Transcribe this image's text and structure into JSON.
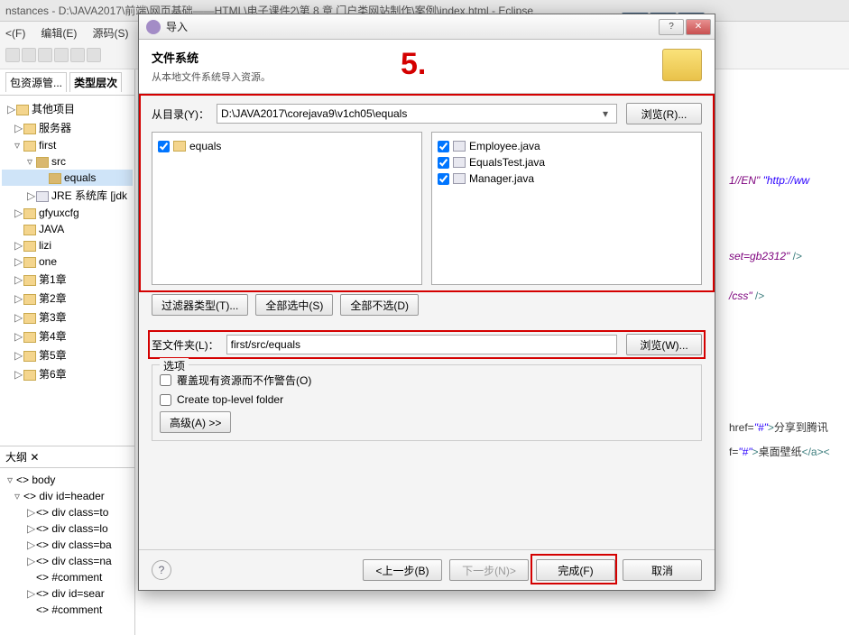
{
  "bg": {
    "title": "nstances - D:\\JAVA2017\\前端\\网页基础——HTML\\电子课件2\\第 8 章 门户类网站制作\\案例\\index.html - Eclipse",
    "menu": [
      "<(F)",
      "编辑(E)",
      "源码(S)"
    ],
    "tabs": {
      "pkg": "包资源管...",
      "hier": "类型层次"
    },
    "tree": [
      {
        "label": "其他项目",
        "lvl": 0,
        "exp": "▷",
        "ico": "fico"
      },
      {
        "label": "服务器",
        "lvl": 1,
        "exp": "▷",
        "ico": "fico"
      },
      {
        "label": "first",
        "lvl": 1,
        "exp": "▿",
        "ico": "fico"
      },
      {
        "label": "src",
        "lvl": 2,
        "exp": "▿",
        "ico": "fico pkg"
      },
      {
        "label": "equals",
        "lvl": 3,
        "exp": "",
        "ico": "fico pkg",
        "selected": true
      },
      {
        "label": "JRE 系统库 [jdk",
        "lvl": 2,
        "exp": "▷",
        "ico": "fico cls"
      },
      {
        "label": "gfyuxcfg",
        "lvl": 1,
        "exp": "▷",
        "ico": "fico"
      },
      {
        "label": "JAVA",
        "lvl": 1,
        "exp": "",
        "ico": "fico"
      },
      {
        "label": "lizi",
        "lvl": 1,
        "exp": "▷",
        "ico": "fico"
      },
      {
        "label": "one",
        "lvl": 1,
        "exp": "▷",
        "ico": "fico"
      },
      {
        "label": "第1章",
        "lvl": 1,
        "exp": "▷",
        "ico": "fico"
      },
      {
        "label": "第2章",
        "lvl": 1,
        "exp": "▷",
        "ico": "fico"
      },
      {
        "label": "第3章",
        "lvl": 1,
        "exp": "▷",
        "ico": "fico"
      },
      {
        "label": "第4章",
        "lvl": 1,
        "exp": "▷",
        "ico": "fico"
      },
      {
        "label": "第5章",
        "lvl": 1,
        "exp": "▷",
        "ico": "fico"
      },
      {
        "label": "第6章",
        "lvl": 1,
        "exp": "▷",
        "ico": "fico"
      }
    ],
    "outline_title": "大纲",
    "outline": [
      {
        "label": "body",
        "lvl": 0,
        "exp": "▿"
      },
      {
        "label": "div id=header",
        "lvl": 1,
        "exp": "▿"
      },
      {
        "label": "div class=to",
        "lvl": 2,
        "exp": "▷"
      },
      {
        "label": "div class=lo",
        "lvl": 2,
        "exp": "▷"
      },
      {
        "label": "div class=ba",
        "lvl": 2,
        "exp": "▷"
      },
      {
        "label": "div class=na",
        "lvl": 2,
        "exp": "▷"
      },
      {
        "label": "#comment",
        "lvl": 2,
        "exp": ""
      },
      {
        "label": "div id=sear",
        "lvl": 2,
        "exp": "▷"
      },
      {
        "label": "#comment",
        "lvl": 2,
        "exp": ""
      }
    ],
    "code_lines": [
      {
        "frag": [
          {
            "t": "1//EN\" ",
            "c": "attr"
          },
          {
            "t": "\"http://ww",
            "c": "str"
          }
        ]
      },
      {
        "frag": [
          {
            "t": "set=gb2312\"",
            "c": "attr"
          },
          {
            "t": " />",
            "c": "tag"
          }
        ]
      },
      {
        "frag": [
          {
            "t": "/css\"",
            "c": "attr"
          },
          {
            "t": " />",
            "c": "tag"
          }
        ]
      },
      {
        "frag": [
          {
            "t": "href=",
            "c": ""
          },
          {
            "t": "\"#\"",
            "c": "str"
          },
          {
            "t": ">",
            "c": "tag"
          },
          {
            "t": "分享到腾讯",
            "c": ""
          }
        ]
      },
      {
        "frag": [
          {
            "t": "f=",
            "c": ""
          },
          {
            "t": "\"#\"",
            "c": "str"
          },
          {
            "t": ">",
            "c": "tag"
          },
          {
            "t": "桌面壁纸",
            "c": ""
          },
          {
            "t": "</a><",
            "c": "tag"
          }
        ]
      }
    ]
  },
  "dialog": {
    "title": "导入",
    "header_title": "文件系统",
    "header_sub": "从本地文件系统导入资源。",
    "annotation": "5.",
    "from_dir_label": "从目录(Y)：",
    "from_dir_value": "D:\\JAVA2017\\corejava9\\v1ch05\\equals",
    "browse_r": "浏览(R)...",
    "tree_item": "equals",
    "files": [
      "Employee.java",
      "EqualsTest.java",
      "Manager.java"
    ],
    "filter_type": "过滤器类型(T)...",
    "select_all": "全部选中(S)",
    "deselect_all": "全部不选(D)",
    "to_folder_label": "至文件夹(L)：",
    "to_folder_value": "first/src/equals",
    "browse_w": "浏览(W)...",
    "options_legend": "选项",
    "opt_overwrite": "覆盖现有资源而不作警告(O)",
    "opt_toplevel": "Create top-level folder",
    "advanced": "高级(A) >>",
    "help": "?",
    "back": "<上一步(B)",
    "next": "下一步(N)>",
    "finish": "完成(F)",
    "cancel": "取消"
  }
}
